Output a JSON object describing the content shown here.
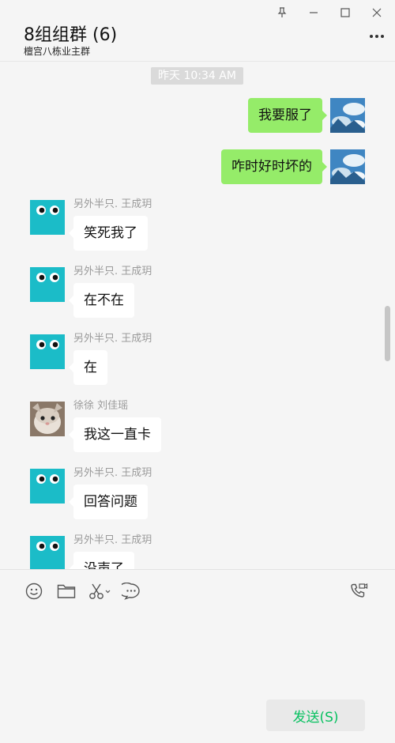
{
  "header": {
    "title": "8组组群 (6)",
    "subtitle": "檀宫八栋业主群"
  },
  "window_controls": [
    "pin-icon",
    "minimize-icon",
    "maximize-icon",
    "close-icon"
  ],
  "chat": {
    "timestamp": "昨天 10:34 AM",
    "messages": [
      {
        "side": "right",
        "sender": "",
        "text": "我要服了"
      },
      {
        "side": "right",
        "sender": "",
        "text": "咋时好时坏的"
      },
      {
        "side": "left",
        "sender": "另外半只. 王成玥",
        "text": "笑死我了"
      },
      {
        "side": "left",
        "sender": "另外半只. 王成玥",
        "text": "在不在"
      },
      {
        "side": "left",
        "sender": "另外半只. 王成玥",
        "text": "在"
      },
      {
        "side": "left",
        "sender": "徐徐 刘佳瑶",
        "text": "我这一直卡"
      },
      {
        "side": "left",
        "sender": "另外半只. 王成玥",
        "text": "回答问题"
      },
      {
        "side": "left",
        "sender": "另外半只. 王成玥",
        "text": "没声了"
      }
    ]
  },
  "toolbar": {
    "tools": [
      "emoji-icon",
      "folder-icon",
      "scissors-icon",
      "chat-history-icon",
      "video-call-icon"
    ]
  },
  "composer": {
    "send_label": "发送(S)"
  },
  "colors": {
    "my_bubble": "#95ec69",
    "other_bubble": "#ffffff",
    "avatar_teal": "#1bbcc8",
    "send_text": "#07c160"
  }
}
